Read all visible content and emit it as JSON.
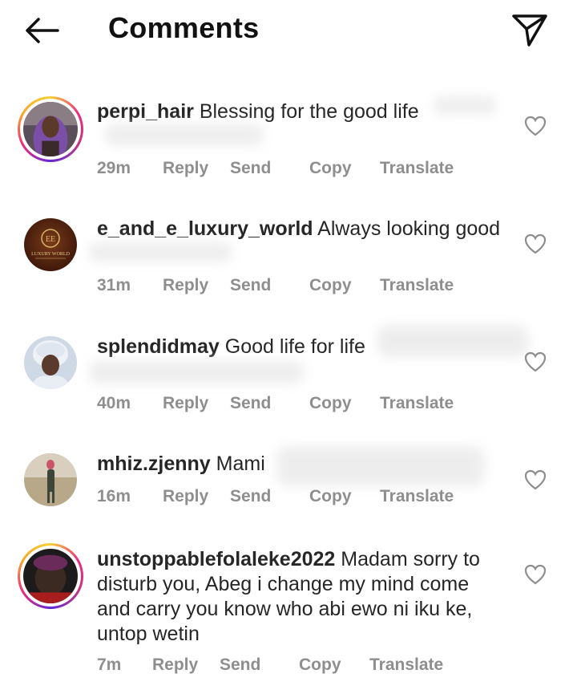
{
  "header": {
    "title": "Comments",
    "back_icon": "arrow-left-icon",
    "share_icon": "paper-plane-icon"
  },
  "actions": {
    "reply": "Reply",
    "send": "Send",
    "copy": "Copy",
    "translate": "Translate"
  },
  "comments": [
    {
      "username": "perpi_hair",
      "text": "Blessing for the good life",
      "time": "29m",
      "has_story_ring": true
    },
    {
      "username": "e_and_e_luxury_world",
      "text": "Always looking good",
      "time": "31m",
      "has_story_ring": false,
      "avatar_logo_text": "LUXURY WORLD"
    },
    {
      "username": "splendidmay",
      "text": "Good life for life",
      "time": "40m",
      "has_story_ring": false
    },
    {
      "username": "mhiz.zjenny",
      "text": "Mami",
      "time": "16m",
      "has_story_ring": false
    },
    {
      "username": "unstoppablefolaleke2022",
      "text": "Madam sorry to disturb you, Abeg i change my mind come and carry you know who abi ewo ni iku ke, untop wetin",
      "time": "7m",
      "has_story_ring": true
    }
  ],
  "colors": {
    "text": "#262626",
    "secondary": "#8e8e8e",
    "story_ring": [
      "#f9ce34",
      "#ee2a7b",
      "#6228d7"
    ]
  }
}
